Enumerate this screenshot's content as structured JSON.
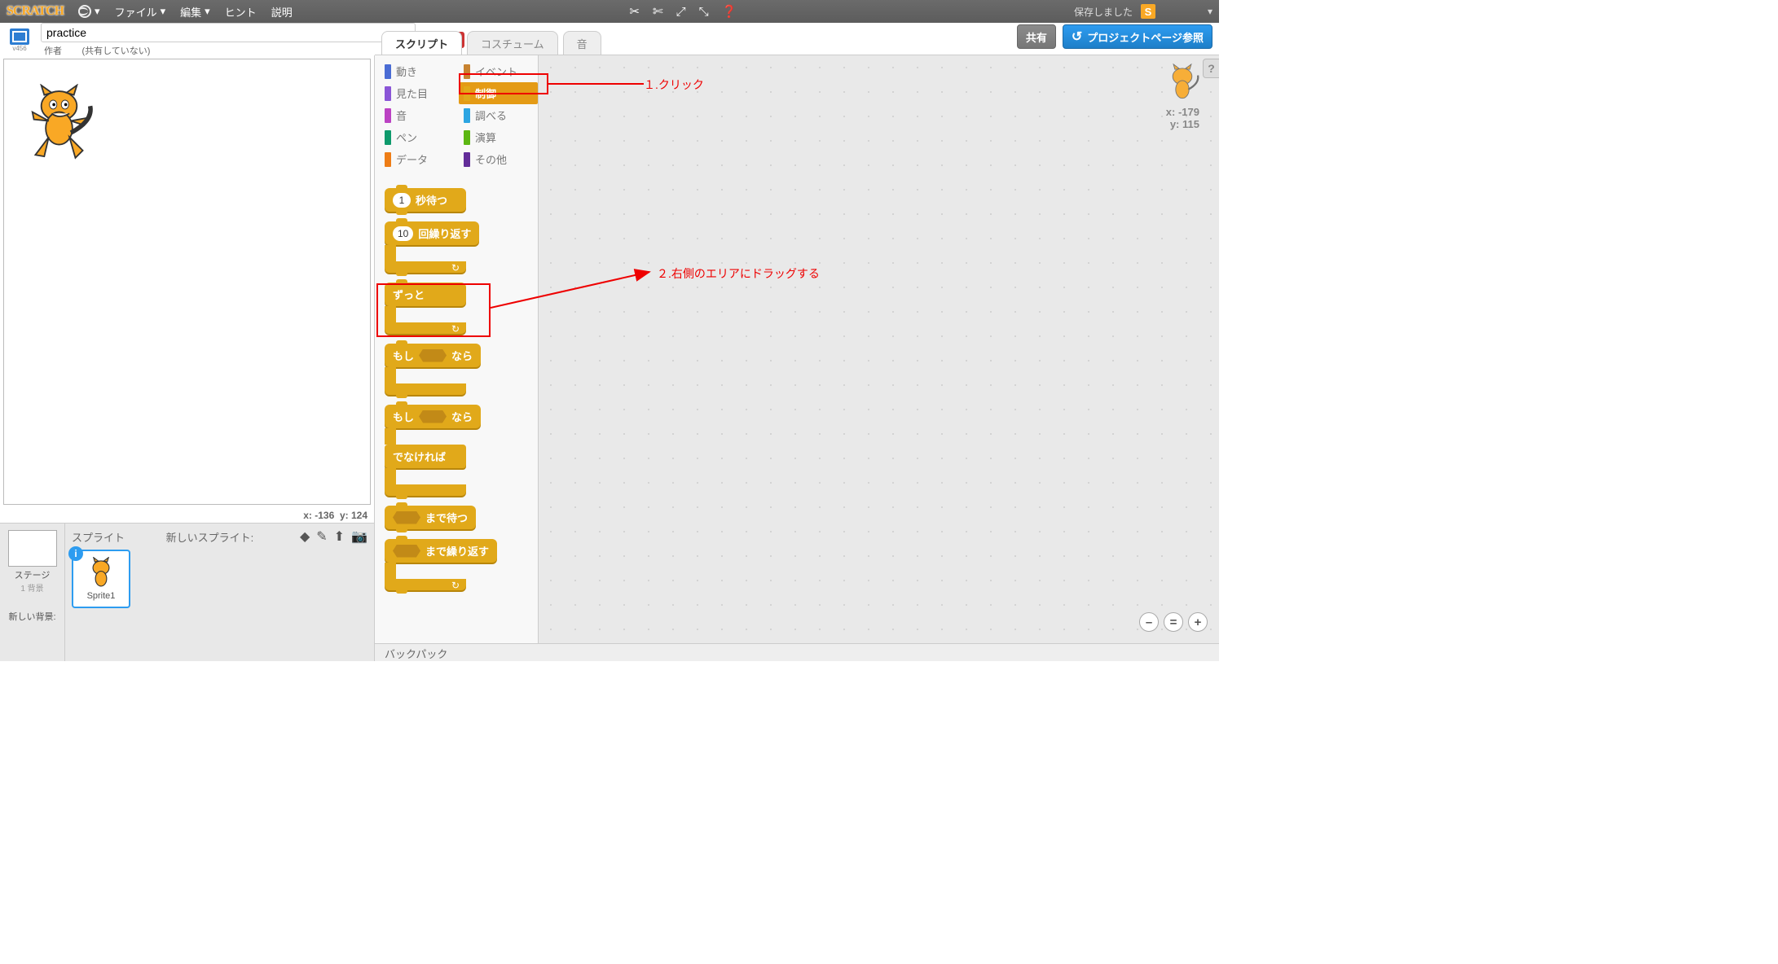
{
  "topbar": {
    "logo": "SCRATCH",
    "file": "ファイル",
    "edit": "編集",
    "hints": "ヒント",
    "about": "説明",
    "saved": "保存しました",
    "user_initial": "S"
  },
  "header": {
    "view_label": "v456",
    "project_name": "practice",
    "author_label": "作者",
    "not_shared": "(共有していない)",
    "share": "共有",
    "project_page": "プロジェクトページ参照"
  },
  "tabs": {
    "scripts": "スクリプト",
    "costumes": "コスチューム",
    "sounds": "音"
  },
  "categories": {
    "motion": "動き",
    "looks": "見た目",
    "sound": "音",
    "pen": "ペン",
    "data": "データ",
    "events": "イベント",
    "control": "制御",
    "sensing": "調べる",
    "operators": "演算",
    "more": "その他"
  },
  "blocks": {
    "wait_num": "1",
    "wait_label": "秒待つ",
    "repeat_num": "10",
    "repeat_label": "回繰り返す",
    "forever": "ずっと",
    "if": "もし",
    "then": "なら",
    "else": "でなければ",
    "wait_until": "まで待つ",
    "repeat_until": "まで繰り返す"
  },
  "stage_coords": {
    "x_label": "x:",
    "x": "-136",
    "y_label": "y:",
    "y": "124"
  },
  "script_coords": {
    "x_label": "x:",
    "x": "-179",
    "y_label": "y:",
    "y": "115"
  },
  "sprite_panel": {
    "sprites_label": "スプライト",
    "new_sprite_label": "新しいスプライト:",
    "stage_label": "ステージ",
    "bg_count": "1 背景",
    "sprite1": "Sprite1",
    "new_bg_label": "新しい背景:"
  },
  "annotations": {
    "a1": "１.クリック",
    "a2": "２.右側のエリアにドラッグする"
  },
  "backpack": "バックパック"
}
